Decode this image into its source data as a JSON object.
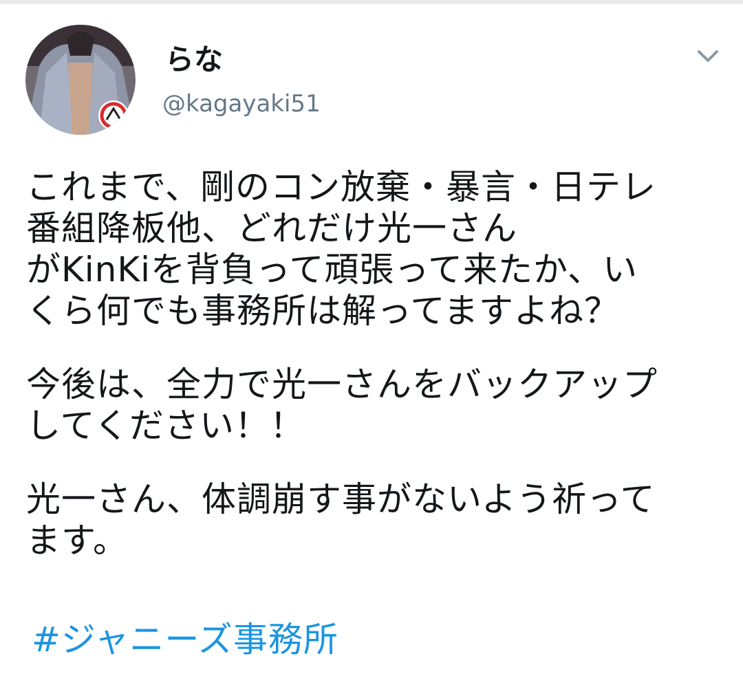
{
  "user": {
    "display_name": "らな",
    "handle": "@kagayaki51",
    "avatar_icon": "profile-avatar"
  },
  "menu": {
    "icon": "chevron-down-icon"
  },
  "tweet": {
    "paragraph_1": [
      "これまで、剛のコン放棄・暴言・日テレ",
      "番組降板他、どれだけ光一さん",
      "がKinKiを背負って頑張って来たか、い",
      "くら何でも事務所は解ってますよね？"
    ],
    "paragraph_2": [
      "今後は、全力で光一さんをバックアップ",
      "してください！！"
    ],
    "paragraph_3": [
      "光一さん、体調崩す事がないよう祈って",
      "ます。"
    ],
    "hashtag": "#ジャニーズ事務所"
  },
  "colors": {
    "text": "#14171a",
    "secondary": "#657786",
    "link": "#1b95e0",
    "chevron": "#8899a6"
  }
}
